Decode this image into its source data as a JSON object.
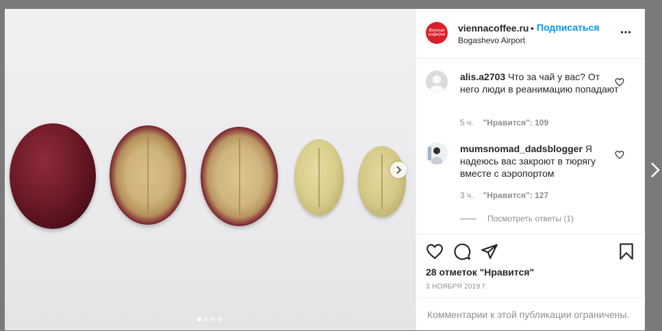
{
  "post": {
    "header": {
      "username": "viennacoffee.ru",
      "separator": "•",
      "follow_label": "Подписаться",
      "location": "Bogashevo Airport",
      "logo_text": "Венская кофейня"
    },
    "media": {
      "carousel_dots": 4,
      "active_dot": 0
    },
    "comments": [
      {
        "username": "alis.a2703",
        "text": "Что за чай у вас? От него люди в реанимацию попадают",
        "time": "5 ч.",
        "likes_label": "\"Нравится\": 109"
      },
      {
        "username": "mumsnomad_dadsblogger",
        "text": "Я надеюсь вас закроют в тюрягу вместе с аэропортом",
        "time": "3 ч.",
        "likes_label": "\"Нравится\": 127",
        "view_replies": "Посмотреть ответы (1)"
      }
    ],
    "likes_summary": "28 отметок \"Нравится\"",
    "date": "3 НОЯБРЯ 2019 Г.",
    "comments_restricted": "Комментарии к этой публикации ограничены."
  },
  "colors": {
    "accent": "#0095f6",
    "logo": "#d9202b",
    "muted": "#8e8e8e",
    "overlay_bg": "#7a7a7a"
  },
  "icons": [
    "more-options-icon",
    "heart-icon",
    "comment-icon",
    "share-icon",
    "bookmark-icon",
    "chevron-right-icon"
  ]
}
